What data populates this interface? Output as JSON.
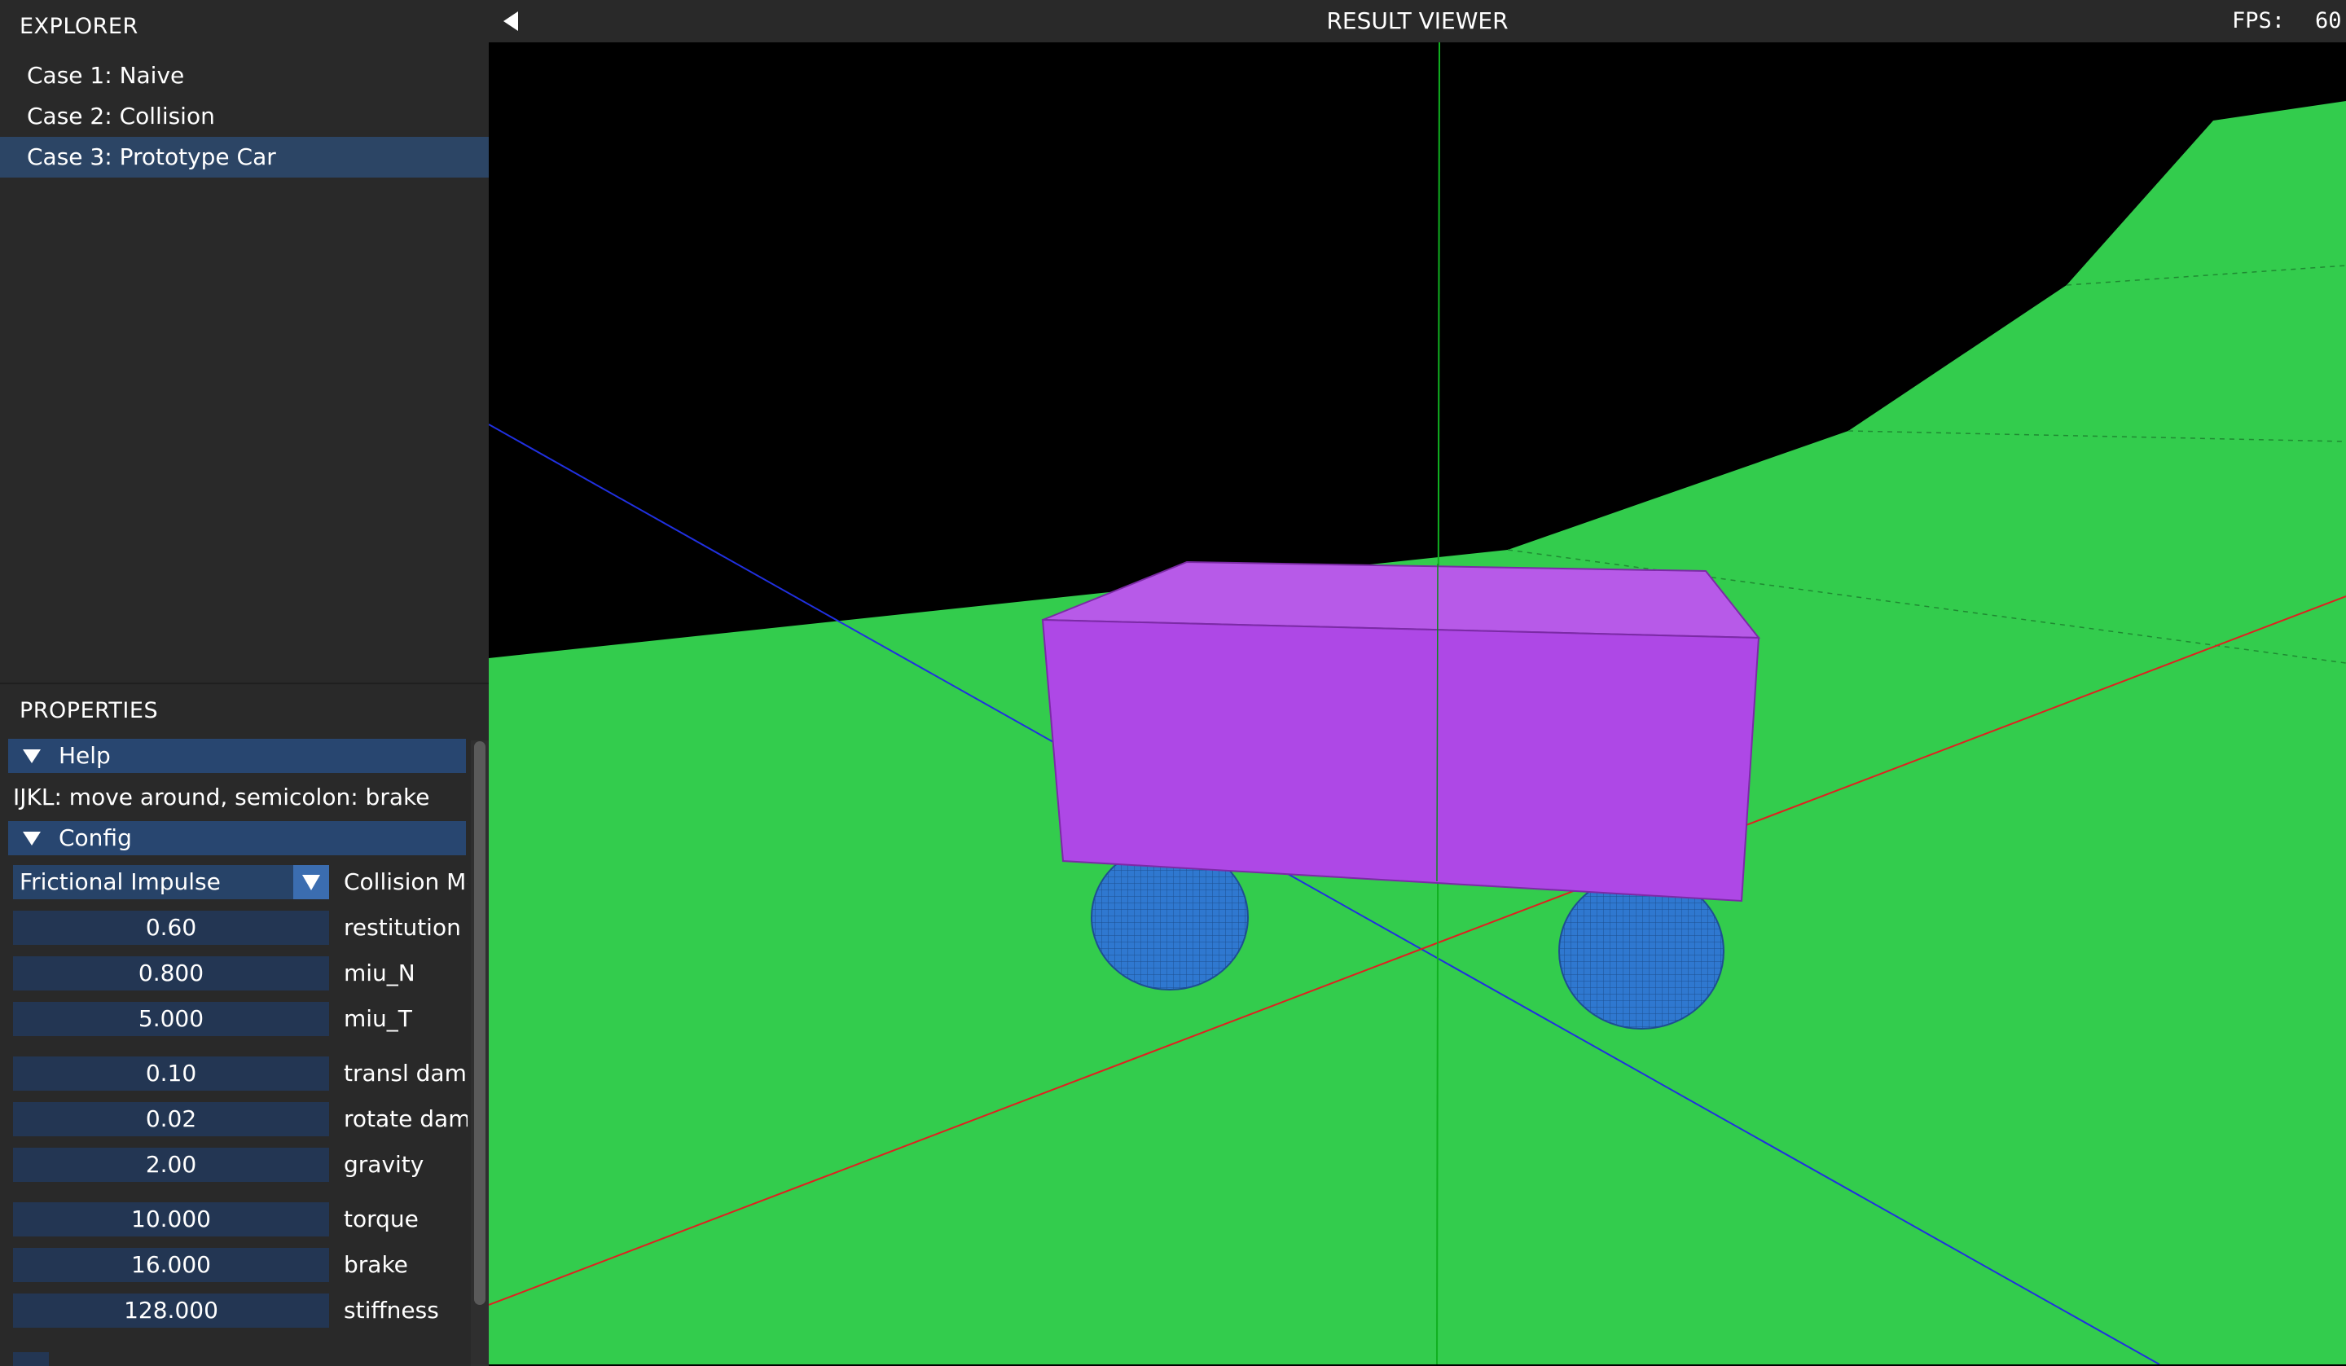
{
  "explorer": {
    "title": "EXPLORER",
    "cases": [
      {
        "label": "Case 1: Naive",
        "selected": false
      },
      {
        "label": "Case 2: Collision",
        "selected": false
      },
      {
        "label": "Case 3: Prototype Car",
        "selected": true
      }
    ]
  },
  "properties": {
    "title": "PROPERTIES",
    "help": {
      "header": "Help",
      "text": "IJKL: move around, semicolon: brake"
    },
    "config": {
      "header": "Config",
      "collision_method": {
        "value": "Frictional Impulse",
        "label": "Collision Me"
      },
      "fields": [
        {
          "value": "0.60",
          "label": "restitution l"
        },
        {
          "value": "0.800",
          "label": "miu_N"
        },
        {
          "value": "5.000",
          "label": "miu_T"
        },
        {
          "value": "0.10",
          "label": "transl damp"
        },
        {
          "value": "0.02",
          "label": "rotate damp"
        },
        {
          "value": "2.00",
          "label": "gravity"
        },
        {
          "value": "10.000",
          "label": "torque"
        },
        {
          "value": "16.000",
          "label": "brake"
        },
        {
          "value": "128.000",
          "label": "stiffness"
        }
      ]
    }
  },
  "viewer": {
    "title": "RESULT VIEWER",
    "fps_label": "FPS:",
    "fps_value": "60"
  },
  "colors": {
    "panel_bg": "#292929",
    "selected_bg": "#2c4565",
    "header_bg": "#284670",
    "field_bg": "#233653",
    "ground": "#33cc4d",
    "car_body": "#ae48e6",
    "wheel": "#2f78d0",
    "axis_x": "#e02020",
    "axis_y": "#10b020",
    "axis_z": "#2030e0"
  }
}
